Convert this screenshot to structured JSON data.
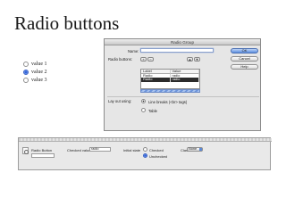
{
  "slide": {
    "title": "Radio buttons"
  },
  "preview": {
    "items": [
      {
        "label": "value 1",
        "selected": false
      },
      {
        "label": "value 2",
        "selected": true
      },
      {
        "label": "value 3",
        "selected": false
      }
    ]
  },
  "dialog": {
    "title": "Radio Group",
    "name_label": "Name:",
    "name_value": "",
    "radio_buttons_label": "Radio buttons:",
    "add_symbol": "+",
    "remove_symbol": "−",
    "up_symbol": "▲",
    "down_symbol": "▼",
    "table": {
      "headers": [
        "Label",
        "Value"
      ],
      "rows": [
        {
          "label": "Radio",
          "value": "radio",
          "selected": false
        },
        {
          "label": "Radio",
          "value": "radio",
          "selected": true
        }
      ]
    },
    "layout_label": "Lay out using:",
    "layout_options": [
      {
        "label": "Line breaks (<br> tags)",
        "selected": true
      },
      {
        "label": "Table",
        "selected": false
      }
    ],
    "ok_label": "OK",
    "cancel_label": "Cancel",
    "help_label": "Help"
  },
  "inspector": {
    "element_label": "Radio Button",
    "element_name": "",
    "checked_value_label": "Checked value",
    "checked_value": "radio",
    "initial_state_label": "Initial state",
    "initial_state_options": [
      {
        "label": "Checked",
        "selected": false
      },
      {
        "label": "Unchecked",
        "selected": true
      }
    ],
    "class_label": "Class",
    "class_value": "None"
  },
  "colors": {
    "accent": "#2f62d9",
    "selection": "#2b2b2b"
  }
}
